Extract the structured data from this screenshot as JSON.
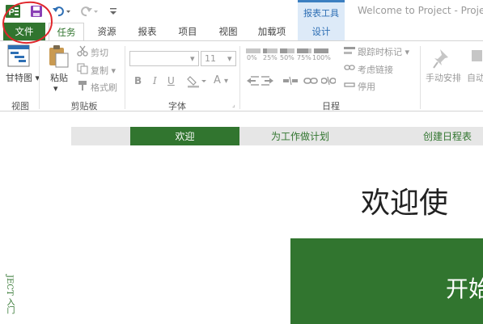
{
  "window": {
    "title": "Welcome to Project - Project",
    "context_group": "报表工具"
  },
  "quick_access": {
    "app_icon": "project-app-icon",
    "save_icon": "save-icon",
    "undo_icon": "undo-icon",
    "redo_icon": "redo-icon",
    "customize_icon": "customize-toolbar-icon"
  },
  "tabs": {
    "file": "文件",
    "task": "任务",
    "resource": "资源",
    "report": "报表",
    "project": "项目",
    "view": "视图",
    "addins": "加载项",
    "design": "设计"
  },
  "ribbon": {
    "view_group": {
      "label": "视图",
      "gantt": "甘特图"
    },
    "clipboard": {
      "label": "剪贴板",
      "paste": "粘贴",
      "cut": "剪切",
      "copy": "复制",
      "format_painter": "格式刷"
    },
    "font": {
      "label": "字体",
      "font_name": "",
      "font_size": "11",
      "bold": "B",
      "italic": "I",
      "underline": "U",
      "font_color": "A"
    },
    "schedule": {
      "label": "日程",
      "pct_buttons": [
        "0%",
        "25%",
        "50%",
        "75%",
        "100%"
      ],
      "mark_on_track": "跟踪时标记",
      "respect_links": "考虑链接",
      "inactivate": "停用"
    },
    "tasks": {
      "manual": "手动安排",
      "auto": "自动"
    }
  },
  "welcome": {
    "nav": {
      "welcome": "欢迎",
      "plan": "为工作做计划",
      "schedule": "创建日程表"
    },
    "heading": "欢迎使",
    "panel_text": "开始",
    "side_text": "JECT 入门"
  },
  "colors": {
    "accent_green": "#31752f",
    "context_blue": "#3c7fc1",
    "annotation_red": "#e0262b"
  }
}
